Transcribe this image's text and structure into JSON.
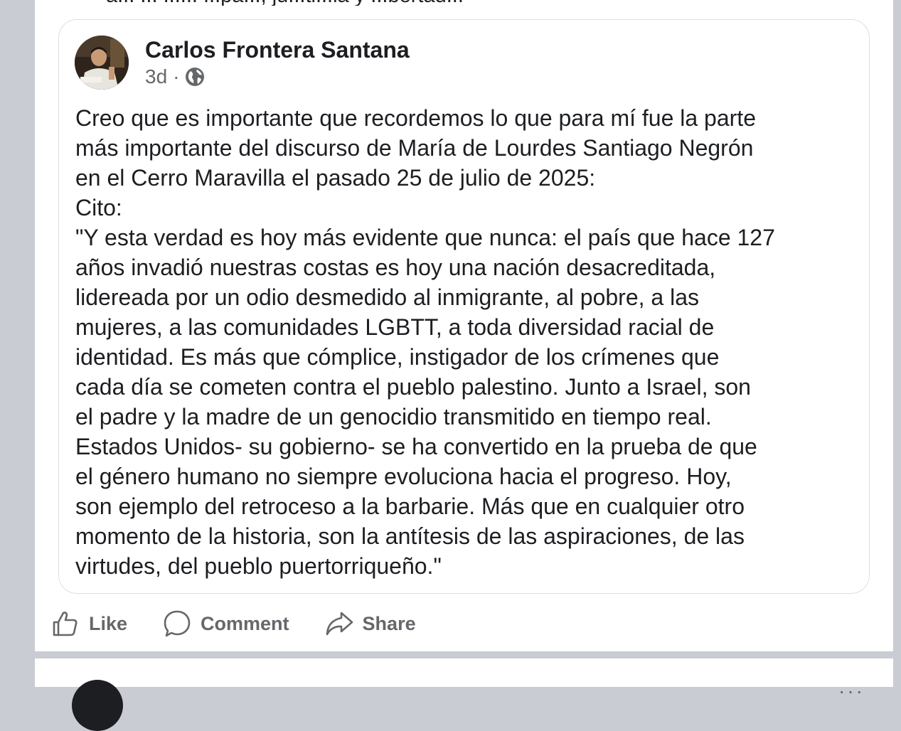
{
  "previous_post": {
    "cut_off_text": "a... ... ...... ...pa..., ju...ti...ia y ...bertad..."
  },
  "shared_post": {
    "author": "Carlos Frontera Santana",
    "time": "3d",
    "separator": "·",
    "privacy_icon": "globe-icon",
    "body_lines": [
      "Creo que es importante que recordemos lo que para mí fue la parte",
      "más importante del discurso de María de Lourdes Santiago Negrón",
      "en el Cerro Maravilla el pasado 25 de julio de 2025:",
      "Cito:",
      "\"Y esta verdad es hoy más evidente que nunca: el país que hace 127",
      "años invadió nuestras costas es hoy una nación desacreditada,",
      "lidereada por un odio desmedido al inmigrante, al pobre, a las",
      "mujeres, a las comunidades LGBTT, a toda diversidad racial de",
      "identidad. Es más que cómplice, instigador de los crímenes que",
      "cada día se cometen contra el pueblo palestino. Junto a Israel, son",
      "el padre y la madre de un genocidio transmitido en tiempo real.",
      "Estados Unidos- su gobierno- se ha convertido en la prueba de que",
      "el género humano no siempre evoluciona hacia el progreso. Hoy,",
      "son ejemplo del retroceso a la barbarie. Más que en cualquier otro",
      "momento de la historia, son la antítesis de las aspiraciones, de las",
      "virtudes, del pueblo puertorriqueño.\""
    ]
  },
  "actions": {
    "like": "Like",
    "comment": "Comment",
    "share": "Share"
  },
  "colors": {
    "text": "#1c1e21",
    "secondary": "#65676b",
    "background": "#c9ccd2",
    "card": "#ffffff"
  }
}
